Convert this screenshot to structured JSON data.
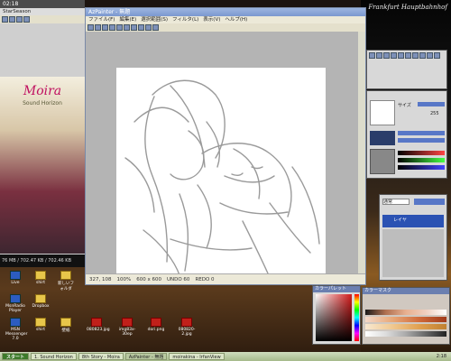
{
  "desktop": {
    "station_text": "Frankfurt Hauptbahnhof",
    "icons": [
      {
        "label": "Live",
        "kind": "blue"
      },
      {
        "label": "shirt",
        "kind": "yellow"
      },
      {
        "label": "新しいフォルダ",
        "kind": "yellow"
      },
      {
        "label": "MsnRadio Player",
        "kind": "blue"
      },
      {
        "label": "Dropbox",
        "kind": "yellow"
      },
      {
        "label": "MSN Messenger 7.0",
        "kind": "blue"
      },
      {
        "label": "shirt",
        "kind": "yellow"
      },
      {
        "label": "壁紙",
        "kind": "yellow"
      },
      {
        "label": "080823.jpg",
        "kind": "red"
      },
      {
        "label": "img83x-30ep",
        "kind": "red"
      },
      {
        "label": "dori.png",
        "kind": "red"
      },
      {
        "label": "080820-2.jpg",
        "kind": "red"
      }
    ]
  },
  "left_window": {
    "time": "02:18",
    "name": "StarSeason",
    "promo_title": "Moira",
    "promo_subtitle": "Sound Horizon",
    "stats": "76 MB / 702.47 KB / 702.46 KB"
  },
  "main_window": {
    "title": "AzPainter - 無題",
    "menu": [
      "ファイル(F)",
      "編集(E)",
      "選択範囲(S)",
      "フィルタ(L)",
      "表示(V)",
      "ヘルプ(H)"
    ],
    "status": {
      "coords": "327, 108",
      "size": "600 x 600",
      "undo": "UNDO 60",
      "redo": "REDO 0",
      "zoom": "100%"
    }
  },
  "palettes": {
    "brush": {
      "size_label": "サイズ",
      "size_value": "2",
      "density_value": "255"
    },
    "layer": {
      "title": "レイヤ",
      "mode": "通常",
      "opacity": "100%",
      "layer_name": "レイヤ"
    },
    "color": {
      "title": "カラーパレット"
    },
    "swatch": {
      "title": "カラーマスク"
    }
  },
  "taskbar": {
    "start": "スタート",
    "items": [
      "1. Sound Horizon",
      "8th Story - Moira",
      "AzPainter - 無題",
      "moirakina - IrfanView"
    ],
    "clock": "2:18"
  }
}
